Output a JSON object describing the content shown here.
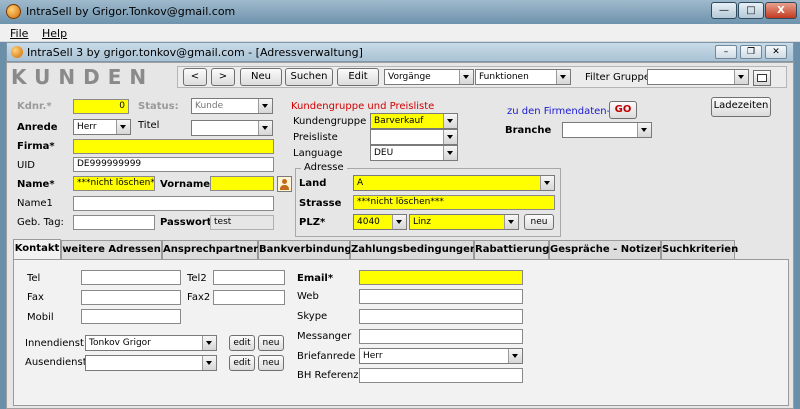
{
  "app": {
    "title": "IntraSell by Grigor.Tonkov@gmail.com",
    "window_buttons": {
      "minimize": "—",
      "maximize": "□",
      "close": "X"
    }
  },
  "menu": {
    "file": "File",
    "help": "Help"
  },
  "inner_window": {
    "title": "IntraSell 3 by grigor.tonkov@gmail.com - [Adressverwaltung]",
    "buttons": {
      "minimize": "–",
      "restore": "❐",
      "close": "✕"
    }
  },
  "header": {
    "title": "KUNDEN"
  },
  "toolbar": {
    "prev": "<",
    "next": ">",
    "neu": "Neu",
    "suchen": "Suchen",
    "edit": "Edit",
    "vorgaenge": "Vorgänge",
    "funktionen": "Funktionen",
    "filter_label": "Filter Gruppe:",
    "filter_value": ""
  },
  "form": {
    "kdnr_label": "Kdnr.*",
    "kdnr_value": "0",
    "status_label": "Status:",
    "status_value": "Kunde",
    "anrede_label": "Anrede",
    "anrede_value": "Herr",
    "titel_label": "Titel",
    "titel_value": "",
    "firma_label": "Firma*",
    "firma_value": "",
    "uid_label": "UID",
    "uid_value": "DE999999999",
    "name_label": "Name*",
    "name_value": "***nicht löschen**",
    "vorname_label": "Vorname",
    "vorname_value": "",
    "name1_label": "Name1",
    "name1_value": "",
    "gebtag_label": "Geb. Tag:",
    "gebtag_value": "",
    "passwort_label": "Passwort",
    "passwort_value": "test"
  },
  "gruppe": {
    "heading": "Kundengruppe und Preisliste",
    "kundengruppe_label": "Kundengruppe",
    "kundengruppe_value": "Barverkauf",
    "preisliste_label": "Preisliste",
    "preisliste_value": "",
    "language_label": "Language",
    "language_value": "DEU"
  },
  "firmendaten": {
    "link": "zu den Firmendaten->",
    "go": "GO",
    "ladezeiten": "Ladezeiten",
    "branche_label": "Branche",
    "branche_value": ""
  },
  "adresse": {
    "legend": "Adresse",
    "land_label": "Land",
    "land_value": "A",
    "strasse_label": "Strasse",
    "strasse_value": "***nicht löschen***",
    "plz_label": "PLZ*",
    "plz_value": "4040",
    "ort_value": "Linz",
    "neu": "neu"
  },
  "tabs": [
    {
      "label": "Kontakt"
    },
    {
      "label": "weitere Adressen"
    },
    {
      "label": "Ansprechpartner"
    },
    {
      "label": "Bankverbindung"
    },
    {
      "label": "Zahlungsbedingungen"
    },
    {
      "label": "Rabattierung"
    },
    {
      "label": "Gespräche - Notizen"
    },
    {
      "label": "Suchkriterien"
    }
  ],
  "kontakt": {
    "tel_label": "Tel",
    "tel_value": "",
    "tel2_label": "Tel2",
    "tel2_value": "",
    "fax_label": "Fax",
    "fax_value": "",
    "fax2_label": "Fax2",
    "fax2_value": "",
    "mobil_label": "Mobil",
    "mobil_value": "",
    "innendienst_label": "Innendienst",
    "innendienst_value": "Tonkov Grigor",
    "aussendienst_label": "Ausendienst",
    "aussendienst_value": "",
    "edit": "edit",
    "neu": "neu",
    "email_label": "Email*",
    "email_value": "",
    "web_label": "Web",
    "web_value": "",
    "skype_label": "Skype",
    "skype_value": "",
    "messanger_label": "Messanger",
    "messanger_value": "",
    "briefanrede_label": "Briefanrede",
    "briefanrede_value": "Herr",
    "bhref_label": "BH Referenz",
    "bhref_value": ""
  }
}
